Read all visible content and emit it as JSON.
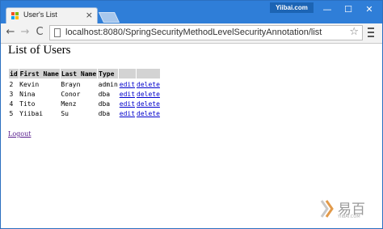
{
  "browser": {
    "tab_title": "User's List",
    "tab_close": "×",
    "brand_badge": "Yiibai.com",
    "url": "localhost:8080/SpringSecurityMethodLevelSecurityAnnotation/list",
    "window_controls": {
      "minimize": "—",
      "maximize": "☐",
      "close": "✕"
    },
    "nav": {
      "back": "←",
      "forward": "→",
      "reload": "C"
    },
    "star": "☆",
    "accent_color": "#2f7ed8"
  },
  "page": {
    "heading": "List of Users",
    "table": {
      "headers": [
        "id",
        "First Name",
        "Last Name",
        "Type",
        "",
        ""
      ],
      "rows": [
        {
          "id": "2",
          "first": "Kevin",
          "last": "Brayn",
          "type": "admin",
          "edit": "edit",
          "delete": "delete"
        },
        {
          "id": "3",
          "first": "Nina",
          "last": "Conor",
          "type": "dba",
          "edit": "edit",
          "delete": "delete"
        },
        {
          "id": "4",
          "first": "Tito",
          "last": "Menz",
          "type": "dba",
          "edit": "edit",
          "delete": "delete"
        },
        {
          "id": "5",
          "first": "Yiibai",
          "last": "Su",
          "type": "dba",
          "edit": "edit",
          "delete": "delete"
        }
      ]
    },
    "logout_label": "Logout"
  },
  "watermark": {
    "text": "易百",
    "sub": "YIIBAI.COM"
  }
}
